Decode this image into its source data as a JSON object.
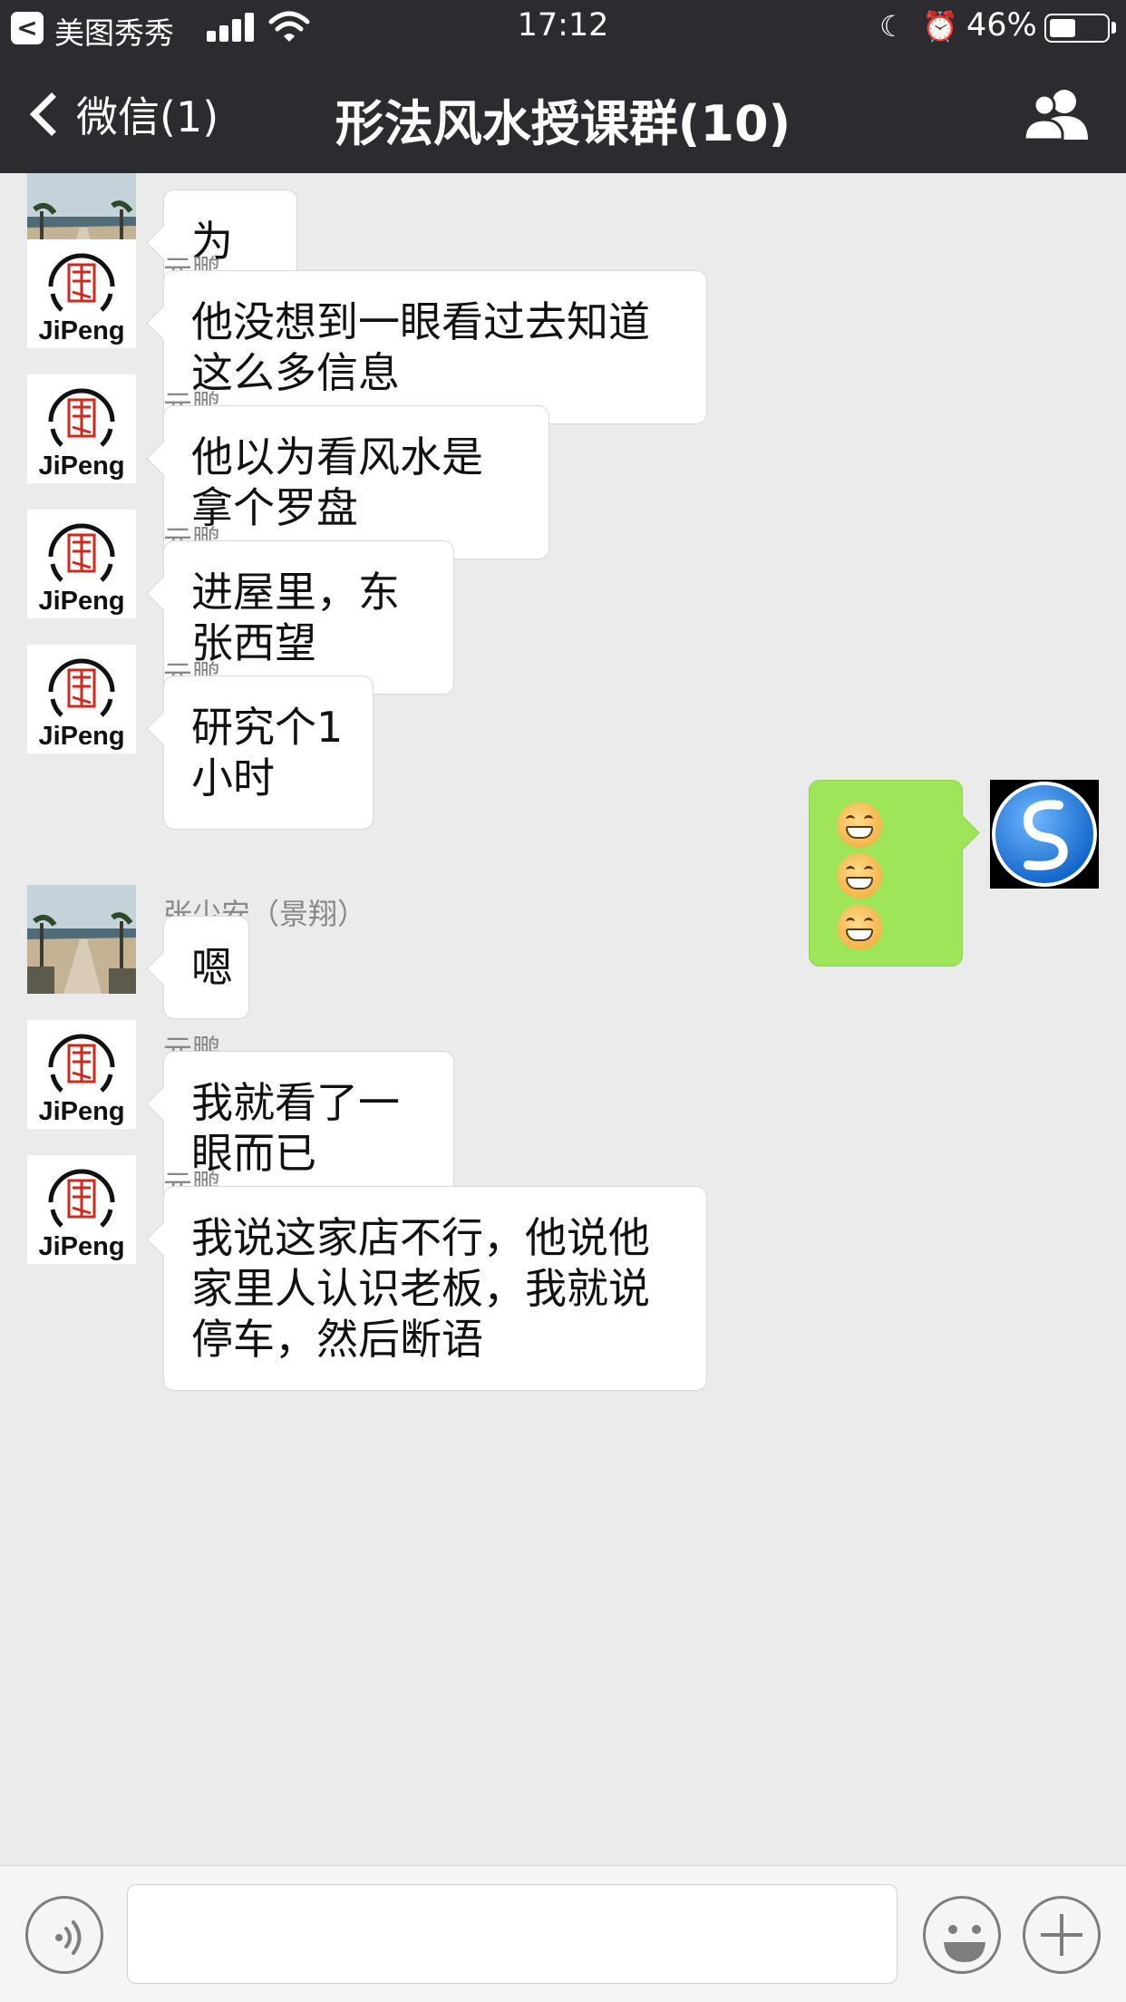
{
  "status_bar": {
    "back_app_glyph": "<",
    "app_name": "美图秀秀",
    "time": "17:12",
    "battery_percent_label": "46%",
    "battery_level": 0.46
  },
  "nav": {
    "back_label": "微信(1)",
    "title": "形法风水授课群(10)"
  },
  "messages": [
    {
      "sender": "张少安（景翔）",
      "avatar": "beach-icon",
      "side": "left",
      "text": "为什么",
      "sender_partially_hidden": true
    },
    {
      "sender": "元鹏",
      "avatar": "jipeng-logo",
      "side": "left",
      "text": "他没想到一眼看过去知道这么多信息"
    },
    {
      "sender": "元鹏",
      "avatar": "jipeng-logo",
      "side": "left",
      "text": "他以为看风水是拿个罗盘"
    },
    {
      "sender": "元鹏",
      "avatar": "jipeng-logo",
      "side": "left",
      "text": "进屋里，东张西望"
    },
    {
      "sender": "元鹏",
      "avatar": "jipeng-logo",
      "side": "left",
      "text": "研究个1小时"
    },
    {
      "sender": "",
      "avatar": "self-avatar",
      "side": "right",
      "emoji_count": 3
    },
    {
      "sender": "张少安（景翔）",
      "avatar": "beach-icon",
      "side": "left",
      "text": "嗯"
    },
    {
      "sender": "元鹏",
      "avatar": "jipeng-logo",
      "side": "left",
      "text": "我就看了一眼而已"
    },
    {
      "sender": "元鹏",
      "avatar": "jipeng-logo",
      "side": "left",
      "text": "我说这家店不行，他说他家里人认识老板，我就说停车，然后断语"
    }
  ],
  "logo_text": "JiPeng",
  "input": {
    "value": ""
  },
  "colors": {
    "header_bg": "#2b2b30",
    "chat_bg": "#ebebeb",
    "my_bubble": "#9fe55a",
    "logo_red": "#d0281c"
  }
}
